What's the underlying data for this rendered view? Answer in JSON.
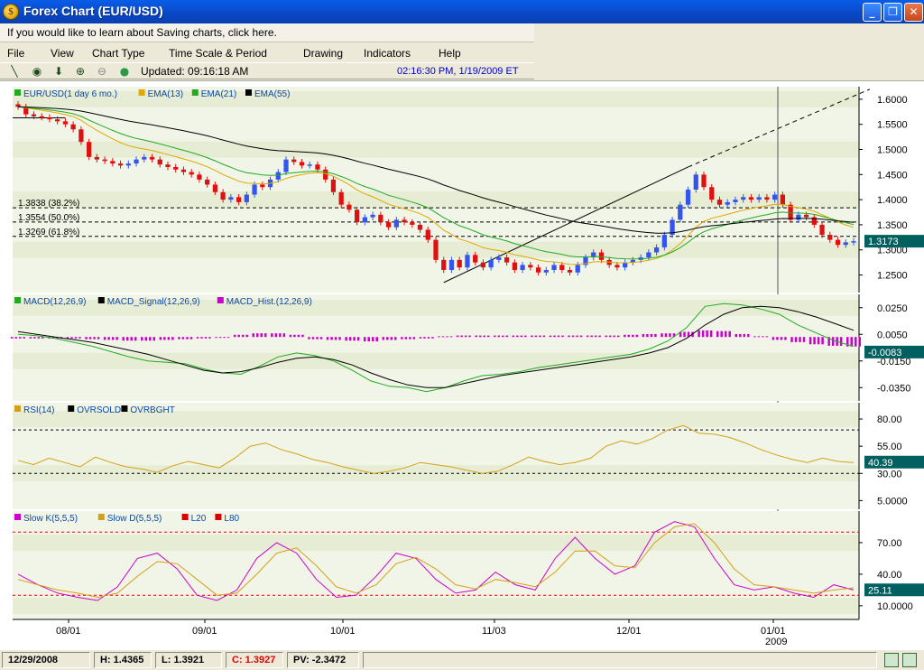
{
  "window": {
    "title": "Forex Chart (EUR/USD)",
    "app_icon_glyph": "$",
    "minimize_glyph": "_",
    "restore_glyph": "❐",
    "close_glyph": "✕"
  },
  "infobar": {
    "text": "If you would like to learn about Saving charts, click here."
  },
  "menu": [
    "File",
    "View",
    "Chart Type",
    "Time Scale & Period",
    "Drawing",
    "Indicators",
    "Help"
  ],
  "toolbar": {
    "icons": [
      {
        "name": "line-draw-icon",
        "glyph": "╲"
      },
      {
        "name": "crosshair-icon",
        "glyph": "◉"
      },
      {
        "name": "arrow-down-icon",
        "glyph": "⬇"
      },
      {
        "name": "zoom-in-icon",
        "glyph": "⊕"
      },
      {
        "name": "zoom-out-icon",
        "glyph": "⊖"
      },
      {
        "name": "globe-icon",
        "glyph": "●"
      }
    ],
    "updated": "Updated: 09:16:18 AM",
    "timestamp": "02:16:30 PM, 1/19/2009 ET"
  },
  "colors": {
    "bg_band": "#f1f5e7",
    "bg_band_alt": "#e6edd4",
    "up_candle": "#3355ee",
    "down_candle": "#dd1111",
    "ema13": "#e0a800",
    "ema21": "#22aa22",
    "ema55": "#000000",
    "macd": "#22aa22",
    "macd_signal": "#000000",
    "macd_hist": "#cc00cc",
    "rsi": "#d4a017",
    "stoch_k": "#cc00cc",
    "stoch_d": "#d4a017",
    "level_red": "#dd0000",
    "badge": "#006060"
  },
  "chart_data": [
    {
      "type": "candlestick",
      "legend": [
        {
          "label": "EUR/USD(1 day  6 mo.)",
          "color": "#22aa22"
        },
        {
          "label": "EMA(13)",
          "color": "#e0a800"
        },
        {
          "label": "EMA(21)",
          "color": "#22aa22"
        },
        {
          "label": "EMA(55)",
          "color": "#000000"
        }
      ],
      "y_ticks": [
        "1.6000",
        "1.5500",
        "1.5000",
        "1.4500",
        "1.4000",
        "1.3500",
        "1.3000",
        "1.2500"
      ],
      "ylim": [
        1.215,
        1.625
      ],
      "fib_levels": [
        {
          "label": "1.3838 (38.2%)",
          "value": 1.3838
        },
        {
          "label": "1.3554 (50.0%)",
          "value": 1.3554
        },
        {
          "label": "1.3269 (61.8%)",
          "value": 1.3269
        }
      ],
      "last_value": "1.3173",
      "close_series": [
        1.585,
        1.57,
        1.566,
        1.564,
        1.56,
        1.556,
        1.55,
        1.54,
        1.515,
        1.485,
        1.48,
        1.477,
        1.472,
        1.468,
        1.472,
        1.48,
        1.485,
        1.48,
        1.47,
        1.465,
        1.46,
        1.455,
        1.45,
        1.44,
        1.43,
        1.415,
        1.4,
        1.405,
        1.395,
        1.41,
        1.43,
        1.425,
        1.44,
        1.455,
        1.48,
        1.475,
        1.468,
        1.47,
        1.46,
        1.44,
        1.415,
        1.39,
        1.38,
        1.355,
        1.365,
        1.37,
        1.355,
        1.345,
        1.36,
        1.355,
        1.35,
        1.34,
        1.32,
        1.28,
        1.26,
        1.28,
        1.265,
        1.29,
        1.275,
        1.265,
        1.28,
        1.285,
        1.275,
        1.26,
        1.27,
        1.265,
        1.255,
        1.26,
        1.27,
        1.26,
        1.255,
        1.27,
        1.285,
        1.295,
        1.28,
        1.27,
        1.265,
        1.275,
        1.28,
        1.285,
        1.295,
        1.305,
        1.33,
        1.36,
        1.39,
        1.42,
        1.45,
        1.425,
        1.4,
        1.39,
        1.395,
        1.4,
        1.405,
        1.4,
        1.405,
        1.4,
        1.41,
        1.39,
        1.36,
        1.37,
        1.365,
        1.35,
        1.33,
        1.32,
        1.31,
        1.315,
        1.3173
      ]
    },
    {
      "type": "line",
      "legend": [
        {
          "label": "MACD(12,26,9)",
          "color": "#22aa22"
        },
        {
          "label": "MACD_Signal(12,26,9)",
          "color": "#000000"
        },
        {
          "label": "MACD_Hist.(12,26,9)",
          "color": "#cc00cc"
        }
      ],
      "y_ticks": [
        "0.0250",
        "0.0050",
        "-0.0150",
        "-0.0350"
      ],
      "ylim": [
        -0.045,
        0.035
      ],
      "last_value": "-0.0083",
      "macd_series": [
        0.005,
        0.004,
        0.002,
        -0.001,
        -0.004,
        -0.008,
        -0.012,
        -0.015,
        -0.016,
        -0.017,
        -0.021,
        -0.024,
        -0.025,
        -0.019,
        -0.012,
        -0.009,
        -0.011,
        -0.015,
        -0.022,
        -0.03,
        -0.034,
        -0.035,
        -0.038,
        -0.035,
        -0.03,
        -0.026,
        -0.025,
        -0.023,
        -0.02,
        -0.018,
        -0.016,
        -0.014,
        -0.012,
        -0.01,
        -0.006,
        0.0,
        0.01,
        0.026,
        0.028,
        0.027,
        0.024,
        0.02,
        0.012,
        0.006,
        0.0,
        -0.004
      ],
      "signal_series": [
        0.007,
        0.005,
        0.003,
        0.001,
        -0.001,
        -0.004,
        -0.007,
        -0.01,
        -0.014,
        -0.018,
        -0.022,
        -0.024,
        -0.023,
        -0.02,
        -0.016,
        -0.013,
        -0.012,
        -0.014,
        -0.018,
        -0.024,
        -0.029,
        -0.033,
        -0.035,
        -0.035,
        -0.032,
        -0.029,
        -0.026,
        -0.024,
        -0.022,
        -0.02,
        -0.018,
        -0.016,
        -0.014,
        -0.012,
        -0.009,
        -0.005,
        0.002,
        0.012,
        0.02,
        0.025,
        0.026,
        0.025,
        0.022,
        0.018,
        0.013,
        0.008
      ],
      "hist_series": [
        -0.002,
        -0.002,
        -0.002,
        -0.002,
        -0.003,
        -0.004,
        -0.005,
        -0.005,
        -0.004,
        -0.003,
        -0.002,
        0.0,
        0.003,
        0.005,
        0.005,
        0.003,
        -0.003,
        -0.004,
        -0.005,
        -0.006,
        -0.004,
        -0.003,
        -0.002,
        0.001,
        0.002,
        0.002,
        0.002,
        0.002,
        0.002,
        0.002,
        0.002,
        0.002,
        0.002,
        0.003,
        0.004,
        0.005,
        0.007,
        0.009,
        0.008,
        0.004,
        0.001,
        -0.004,
        -0.007,
        -0.01,
        -0.012,
        -0.013
      ]
    },
    {
      "type": "line",
      "legend": [
        {
          "label": "RSI(14)",
          "color": "#d4a017"
        },
        {
          "label": "OVRSOLD",
          "color": "#000000"
        },
        {
          "label": "OVRBGHT",
          "color": "#000000"
        }
      ],
      "y_ticks": [
        "80.00",
        "55.00",
        "30.00",
        "5.0000"
      ],
      "ylim": [
        -3,
        95
      ],
      "levels": [
        30,
        70
      ],
      "last_value": "40.39",
      "series": [
        42,
        38,
        44,
        40,
        36,
        45,
        40,
        36,
        34,
        31,
        37,
        41,
        38,
        35,
        44,
        55,
        58,
        52,
        48,
        43,
        40,
        36,
        33,
        30,
        32,
        35,
        40,
        38,
        36,
        33,
        30,
        32,
        38,
        45,
        41,
        38,
        40,
        44,
        55,
        60,
        57,
        62,
        70,
        74,
        67,
        66,
        63,
        58,
        52,
        47,
        43,
        40,
        44,
        41,
        40
      ]
    },
    {
      "type": "line",
      "legend": [
        {
          "label": "Slow K(5,5,5)",
          "color": "#cc00cc"
        },
        {
          "label": "Slow D(5,5,5)",
          "color": "#d4a017"
        },
        {
          "label": "L20",
          "color": "#dd0000"
        },
        {
          "label": "L80",
          "color": "#dd0000"
        }
      ],
      "y_ticks": [
        "70.00",
        "40.00",
        "10.0000"
      ],
      "ylim": [
        -3,
        100
      ],
      "levels": [
        20,
        80
      ],
      "last_value": "25.11",
      "k_series": [
        40,
        30,
        22,
        18,
        15,
        28,
        55,
        60,
        45,
        20,
        15,
        25,
        55,
        70,
        60,
        35,
        18,
        20,
        38,
        60,
        55,
        35,
        22,
        25,
        42,
        30,
        25,
        55,
        75,
        55,
        40,
        48,
        80,
        90,
        85,
        55,
        30,
        25,
        28,
        22,
        18,
        30,
        25
      ],
      "d_series": [
        35,
        30,
        25,
        22,
        18,
        22,
        38,
        52,
        50,
        35,
        20,
        22,
        40,
        60,
        65,
        48,
        28,
        22,
        30,
        50,
        56,
        45,
        30,
        26,
        35,
        32,
        28,
        42,
        62,
        62,
        48,
        46,
        70,
        85,
        88,
        70,
        45,
        30,
        28,
        25,
        22,
        25,
        27
      ]
    }
  ],
  "x_axis": {
    "labels": [
      "08/01",
      "09/01",
      "10/01",
      "11/03",
      "12/01",
      "01/01"
    ],
    "sub_label": "2009"
  },
  "statusbar": {
    "date": "12/29/2008",
    "high": "H: 1.4365",
    "low": "L: 1.3921",
    "close": "C: 1.3927",
    "pv": "PV: -2.3472"
  }
}
